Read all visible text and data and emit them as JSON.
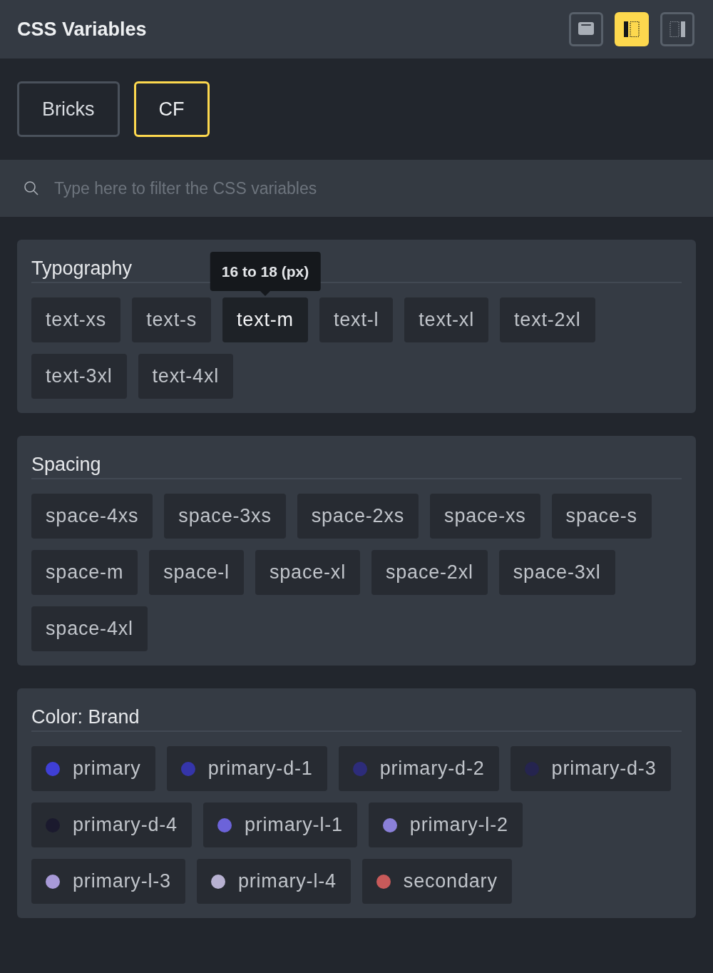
{
  "header": {
    "title": "CSS Variables",
    "layout_buttons": [
      {
        "kind": "top",
        "selected": false
      },
      {
        "kind": "left",
        "selected": true
      },
      {
        "kind": "right",
        "selected": false
      }
    ]
  },
  "frameworks": [
    {
      "label": "Bricks",
      "selected": false
    },
    {
      "label": "CF",
      "selected": true
    }
  ],
  "search": {
    "placeholder": "Type here to filter the CSS variables"
  },
  "groups": [
    {
      "title": "Typography",
      "chips": [
        {
          "label": "text-xs",
          "selected": false
        },
        {
          "label": "text-s",
          "selected": false
        },
        {
          "label": "text-m",
          "selected": true,
          "tooltip": "16 to 18 (px)"
        },
        {
          "label": "text-l",
          "selected": false
        },
        {
          "label": "text-xl",
          "selected": false
        },
        {
          "label": "text-2xl",
          "selected": false
        },
        {
          "label": "text-3xl",
          "selected": false
        },
        {
          "label": "text-4xl",
          "selected": false
        }
      ]
    },
    {
      "title": "Spacing",
      "chips": [
        {
          "label": "space-4xs",
          "selected": false
        },
        {
          "label": "space-3xs",
          "selected": false
        },
        {
          "label": "space-2xs",
          "selected": false
        },
        {
          "label": "space-xs",
          "selected": false
        },
        {
          "label": "space-s",
          "selected": false
        },
        {
          "label": "space-m",
          "selected": false
        },
        {
          "label": "space-l",
          "selected": false
        },
        {
          "label": "space-xl",
          "selected": false
        },
        {
          "label": "space-2xl",
          "selected": false
        },
        {
          "label": "space-3xl",
          "selected": false
        },
        {
          "label": "space-4xl",
          "selected": false
        }
      ]
    },
    {
      "title": "Color: Brand",
      "chips": [
        {
          "label": "primary",
          "selected": false,
          "color": "#3f3fd6"
        },
        {
          "label": "primary-d-1",
          "selected": false,
          "color": "#3535aa"
        },
        {
          "label": "primary-d-2",
          "selected": false,
          "color": "#2d2c7a"
        },
        {
          "label": "primary-d-3",
          "selected": false,
          "color": "#25244f"
        },
        {
          "label": "primary-d-4",
          "selected": false,
          "color": "#1b1a2e"
        },
        {
          "label": "primary-l-1",
          "selected": false,
          "color": "#6c63d9"
        },
        {
          "label": "primary-l-2",
          "selected": false,
          "color": "#8a80d9"
        },
        {
          "label": "primary-l-3",
          "selected": false,
          "color": "#a89ad8"
        },
        {
          "label": "primary-l-4",
          "selected": false,
          "color": "#b8b2d2"
        },
        {
          "label": "secondary",
          "selected": false,
          "color": "#c85a5a"
        }
      ]
    }
  ]
}
